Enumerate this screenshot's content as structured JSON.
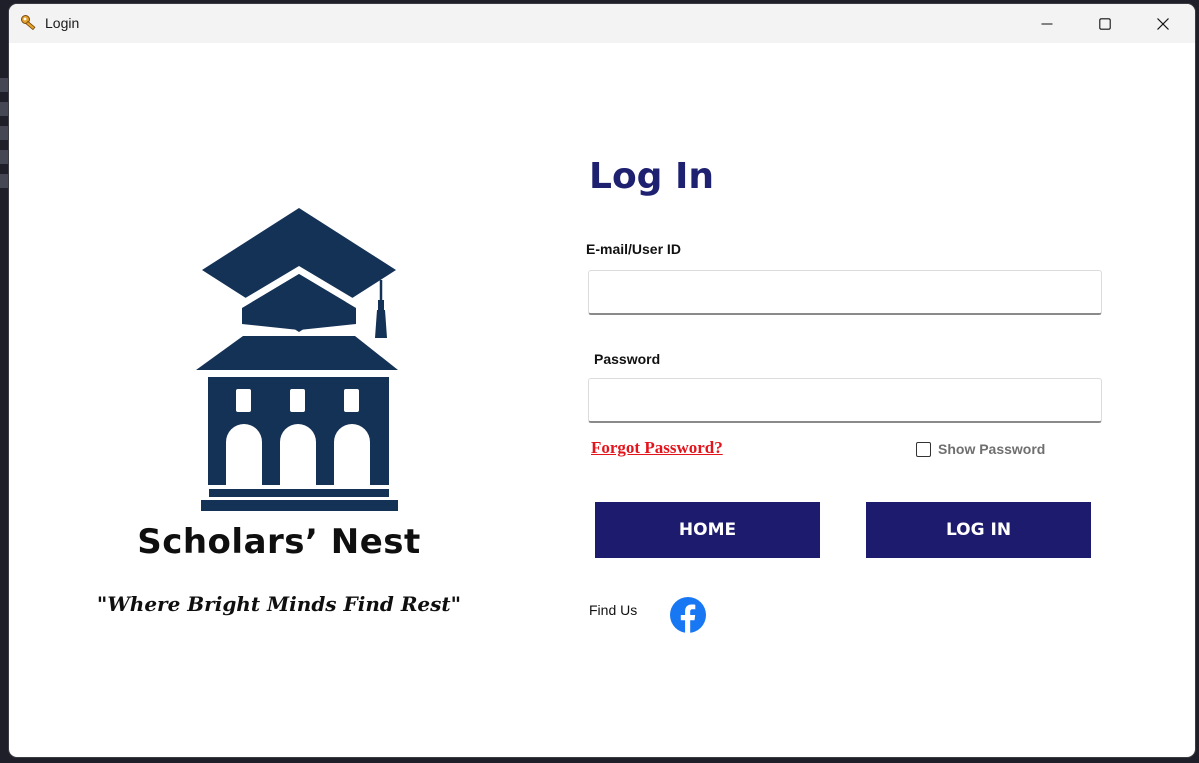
{
  "window": {
    "title": "Login"
  },
  "branding": {
    "name": "Scholars’ Nest",
    "tagline": "\"Where Bright Minds Find Rest\""
  },
  "form": {
    "heading": "Log In",
    "email_label": "E-mail/User ID",
    "email_value": "",
    "password_label": "Password",
    "password_value": "",
    "forgot_label": "Forgot Password?",
    "show_password_label": "Show Password",
    "show_password_checked": false,
    "home_button": "HOME",
    "login_button": "LOG IN",
    "find_us_label": "Find Us"
  },
  "icons": {
    "app": "key-icon",
    "minimize": "minimize-icon",
    "maximize": "maximize-icon",
    "close": "close-icon",
    "logo": "school-building-logo",
    "social": "facebook-icon"
  },
  "colors": {
    "primary": "#1c1b6e",
    "heading": "#1e2170",
    "logo": "#143156",
    "link": "#e4141c",
    "facebook": "#1877f2"
  }
}
